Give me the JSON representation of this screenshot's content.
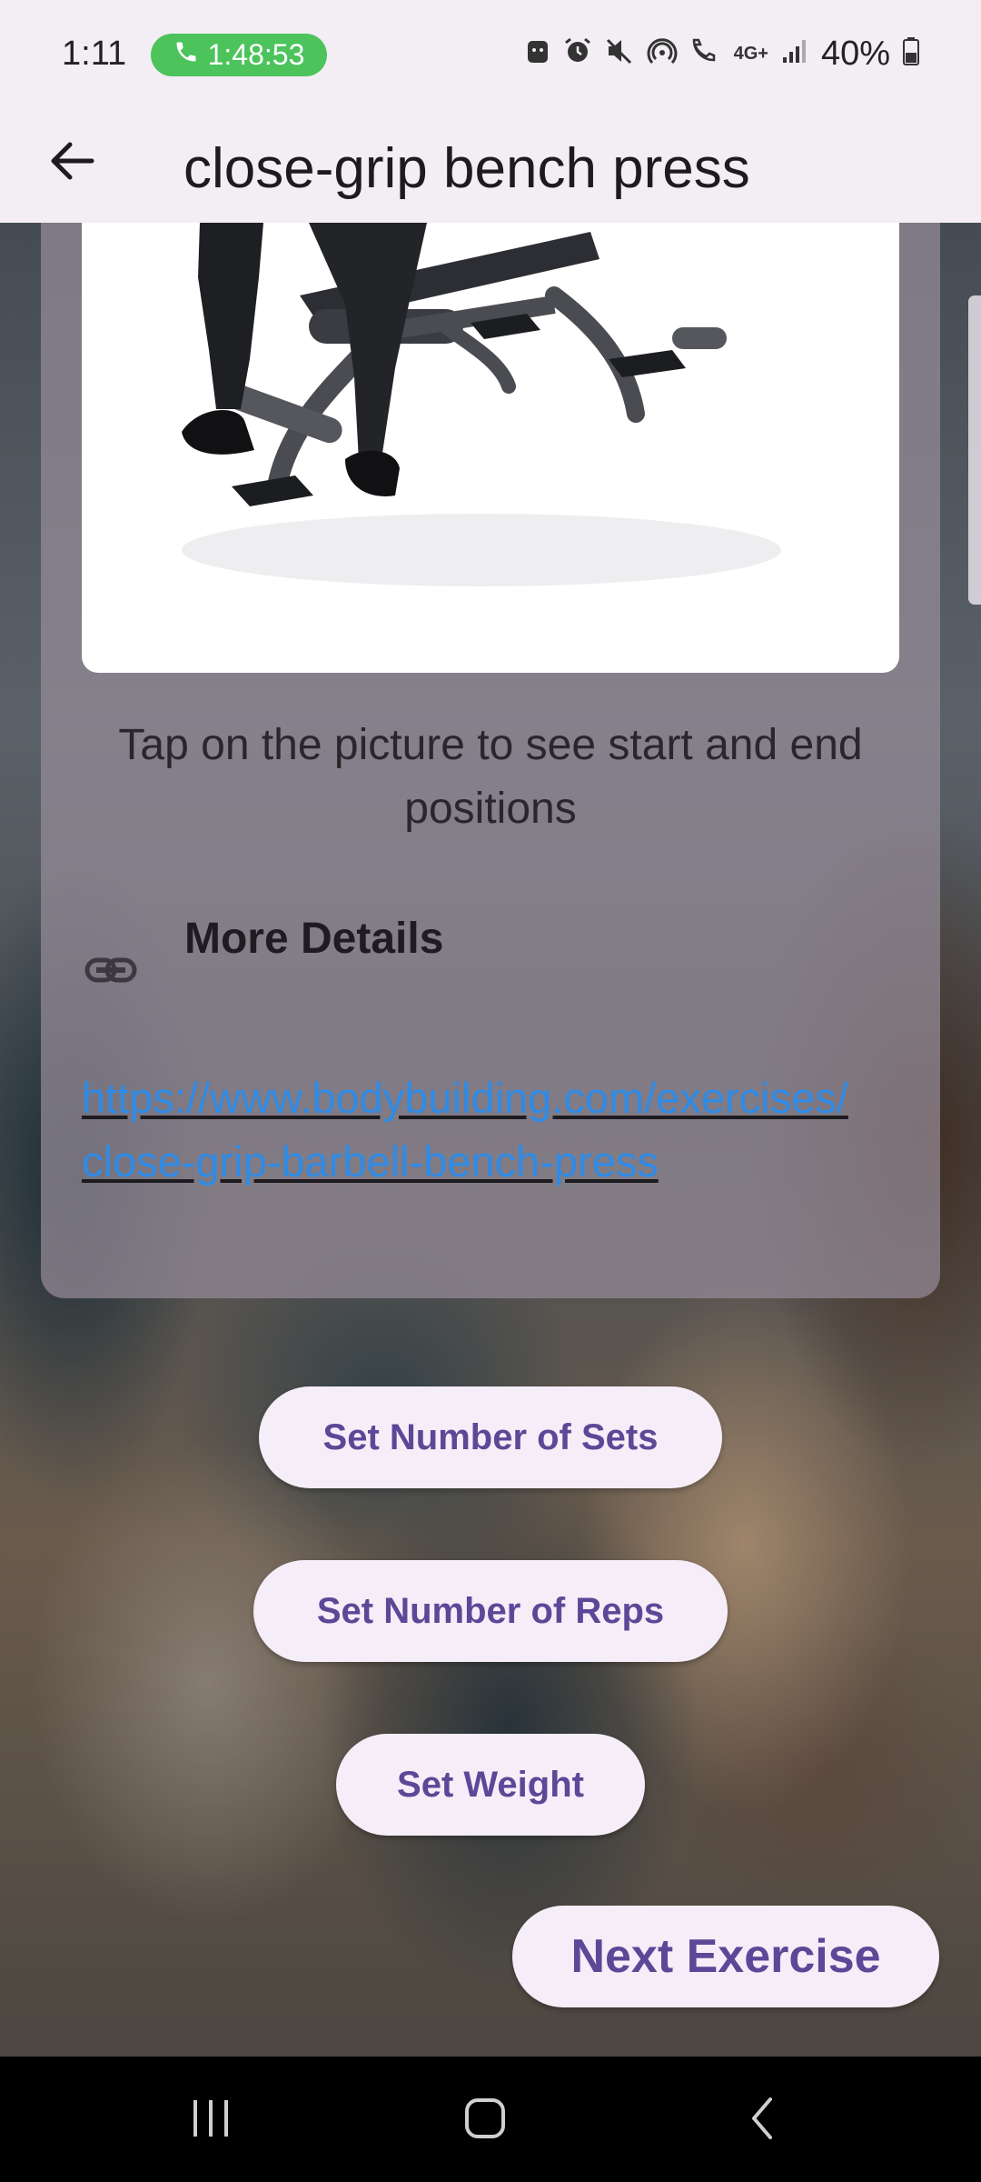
{
  "status_bar": {
    "time": "1:11",
    "call_timer": "1:48:53",
    "network": "4G+",
    "battery": "40%"
  },
  "app_bar": {
    "title": "close-grip bench press",
    "back_icon": "arrow-back-icon"
  },
  "exercise": {
    "image_alt": "person on flat bench",
    "caption": "Tap on the picture to see start and end positions",
    "details_heading": "More Details",
    "details_link": "https://www.bodybuilding.com/exercises/close-grip-barbell-bench-press"
  },
  "actions": {
    "sets_label": "Set Number of Sets",
    "reps_label": "Set Number of Reps",
    "weight_label": "Set Weight",
    "next_label": "Next Exercise"
  },
  "nav": {
    "recents_icon": "recents-icon",
    "home_icon": "home-icon",
    "back_icon": "back-icon"
  },
  "colors": {
    "accent": "#5d4797",
    "link": "#2f8be6",
    "call_pill": "#4cc35b",
    "bar_bg": "#f3eef4"
  }
}
